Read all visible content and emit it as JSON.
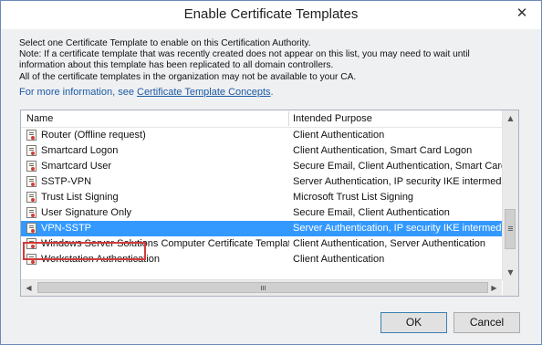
{
  "window": {
    "title": "Enable Certificate Templates",
    "close_glyph": "✕"
  },
  "description": [
    "Select one Certificate Template to enable on this Certification Authority.",
    "Note: If a certificate template that was recently created does not appear on this list, you may need to wait until",
    "information about this template has been replicated to all domain controllers.",
    "All of the certificate templates in the organization may not be available to your CA."
  ],
  "info": {
    "prefix": "For more information, see ",
    "link": "Certificate Template Concepts",
    "suffix": "."
  },
  "list": {
    "columns": {
      "name": "Name",
      "purpose": "Intended Purpose"
    },
    "rows": [
      {
        "name": "Router (Offline request)",
        "purpose": "Client Authentication"
      },
      {
        "name": "Smartcard Logon",
        "purpose": "Client Authentication, Smart Card Logon"
      },
      {
        "name": "Smartcard User",
        "purpose": "Secure Email, Client Authentication, Smart Card I"
      },
      {
        "name": "SSTP-VPN",
        "purpose": "Server Authentication, IP security IKE intermedi"
      },
      {
        "name": "Trust List Signing",
        "purpose": "Microsoft Trust List Signing"
      },
      {
        "name": "User Signature Only",
        "purpose": "Secure Email, Client Authentication"
      },
      {
        "name": "VPN-SSTP",
        "purpose": "Server Authentication, IP security IKE intermedia"
      },
      {
        "name": "Windows Server Solutions Computer Certificate Template",
        "purpose": "Client Authentication, Server Authentication"
      },
      {
        "name": "Workstation Authentication",
        "purpose": "Client Authentication"
      }
    ],
    "selected_row": "VPN-SSTP"
  },
  "buttons": {
    "ok": "OK",
    "cancel": "Cancel"
  },
  "icons": {
    "row_icon": "certificate-template-icon",
    "up": "▲",
    "down": "▼",
    "left": "◀",
    "right": "▶"
  },
  "colors": {
    "selection": "#3399ff",
    "highlight_box": "#d23b3b",
    "link": "#1c5aa6"
  }
}
